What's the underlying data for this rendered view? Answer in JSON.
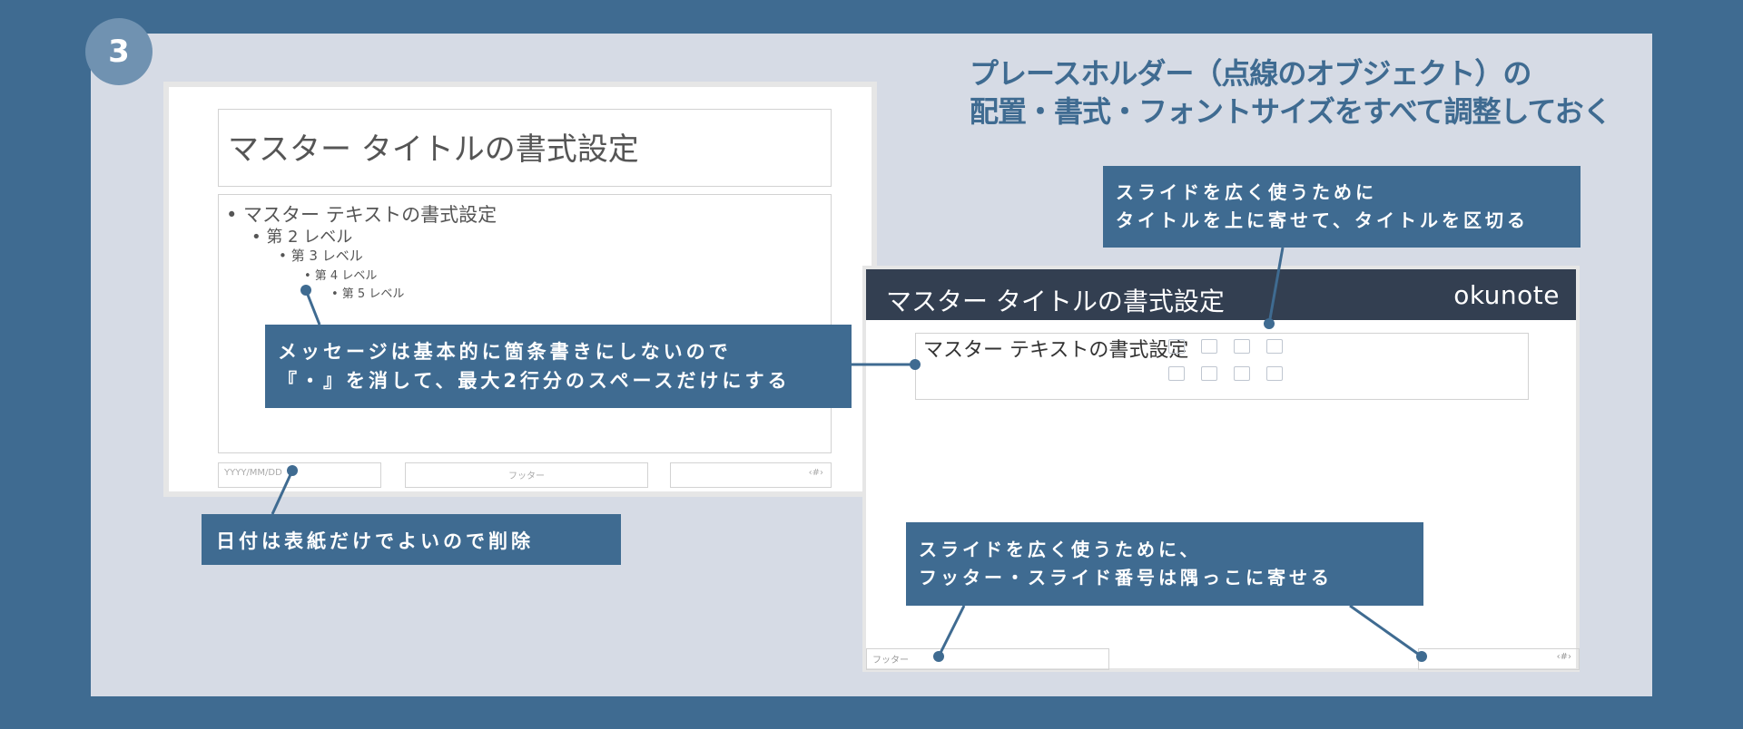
{
  "step": "3",
  "headline": {
    "line1": "プレースホルダー（点線のオブジェクト）の",
    "line2": "配置・書式・フォントサイズをすべて調整しておく"
  },
  "left_slide": {
    "title": "マスター タイトルの書式設定",
    "levels": [
      "• マスター テキストの書式設定",
      "• 第 2 レベル",
      "• 第 3 レベル",
      "• 第 4 レベル",
      "• 第 5 レベル"
    ],
    "date": "YYYY/MM/DD",
    "footer": "フッター",
    "page_number": "‹#›"
  },
  "right_slide": {
    "title": "マスター タイトルの書式設定",
    "logo": "okunote",
    "body": "マスター テキストの書式設定",
    "footer": "フッター",
    "page_number": "‹#›"
  },
  "callouts": {
    "message": {
      "line1": "メッセージは基本的に箇条書きにしないので",
      "line2": "『・』を消して、最大2行分のスペースだけにする"
    },
    "date": "日付は表紙だけでよいので削除",
    "title": {
      "line1": "スライドを広く使うために",
      "line2": "タイトルを上に寄せて、タイトルを区切る"
    },
    "footer": {
      "line1": "スライドを広く使うために、",
      "line2": "フッター・スライド番号は隅っこに寄せる"
    }
  },
  "colors": {
    "background": "#3f6b91",
    "panel": "#d6dbe5",
    "callout": "#3f6b91",
    "title_bar": "#333f51"
  }
}
